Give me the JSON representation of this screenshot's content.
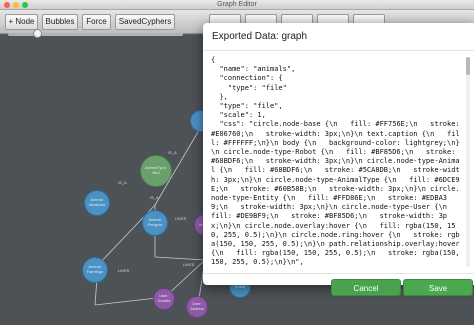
{
  "window": {
    "title": "Graph Editor"
  },
  "toolbar": {
    "buttons": [
      "+ Node",
      "Bubbles",
      "Force",
      "SavedCyphers"
    ],
    "hidden_buttons": [
      "",
      "",
      "",
      "",
      ""
    ]
  },
  "graph": {
    "nodes": [
      {
        "label": "AnimalType: Bird",
        "kind": "type"
      },
      {
        "label": "Animal: Albatross",
        "kind": "animal"
      },
      {
        "label": "Animal: Penguin",
        "kind": "animal"
      },
      {
        "label": "Animal: Flamingo",
        "kind": "animal"
      },
      {
        "label": "User: Donald",
        "kind": "user"
      },
      {
        "label": "User: Andrew",
        "kind": "user"
      },
      {
        "label": "Robot",
        "kind": "robot"
      },
      {
        "label": "Animal",
        "kind": "animal"
      }
    ],
    "edge_labels": [
      "IS_A",
      "IS_A",
      "IS_A",
      "LIKES",
      "LIKES",
      "LIKES"
    ]
  },
  "modal": {
    "title": "Exported Data: graph",
    "content": "{\n  \"name\": \"animals\",\n  \"connection\": {\n    \"type\": \"file\"\n  },\n  \"type\": \"file\",\n  \"scale\": 1,\n  \"css\": \"circle.node-base {\\n   fill: #FF756E;\\n   stroke: #E06760;\\n   stroke-width: 3px;\\n}\\n text.caption {\\n   fill: #FFFFFF;\\n}\\n body {\\n   background-color: lightgrey;\\n}\\n circle.node-type-Robot {\\n   fill: #BF85D6;\\n   stroke: #68BDF6;\\n   stroke-width: 3px;\\n}\\n circle.node-type-Animal {\\n   fill: #68BDF6;\\n   stroke: #5CA8DB;\\n   stroke-width: 3px;\\n}\\n circle.node-type-AnimalType {\\n   fill: #6DCE9E;\\n   stroke: #60B58B;\\n   stroke-width: 3px;\\n}\\n circle.node-type-Entity {\\n   fill: #FFD86E;\\n   stroke: #EDBA39;\\n   stroke-width: 3px;\\n}\\n circle.node-type-User {\\n   fill: #DE9BF9;\\n   stroke: #BF85D6;\\n   stroke-width: 3px;\\n}\\n circle.node.overlay:hover {\\n   fill: rgba(150, 150, 255, 0.5);\\n}\\n circle.node.ring:hover {\\n   stroke: rgba(150, 150, 255, 0.5);\\n}\\n path.relationship.overlay:hover {\\n   fill: rgba(150, 150, 255, 0.5);\\n   stroke: rgba(150, 150, 255, 0.5);\\n}\\n\",",
    "cancel_label": "Cancel",
    "save_label": "Save"
  },
  "colors": {
    "canvas_bg": "#4d5257",
    "button_green": "#4aa84e",
    "node_animal": "#4a91c4",
    "node_type": "#6aa06b",
    "node_user": "#8e5aa8"
  }
}
